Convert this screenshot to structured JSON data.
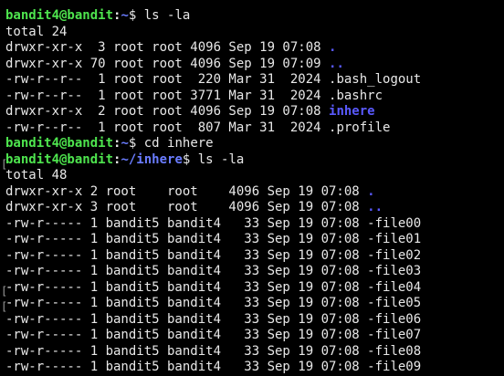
{
  "session": {
    "user_host": "bandit4@bandit",
    "colors": {
      "prompt": "#4ee44e",
      "path": "#6a7cff",
      "directory": "#5a5aff",
      "text": "#e8e8e8",
      "background": "#000000"
    }
  },
  "block1": {
    "prompt_user": "bandit4@bandit",
    "prompt_colon": ":",
    "prompt_path": "~",
    "prompt_dollar": "$ ",
    "command": "ls -la",
    "total": "total 24",
    "rows": [
      {
        "meta": "drwxr-xr-x  3 root root 4096 Sep 19 07:08 ",
        "name": ".",
        "is_dir": true
      },
      {
        "meta": "drwxr-xr-x 70 root root 4096 Sep 19 07:09 ",
        "name": "..",
        "is_dir": true
      },
      {
        "meta": "-rw-r--r--  1 root root  220 Mar 31  2024 ",
        "name": ".bash_logout",
        "is_dir": false
      },
      {
        "meta": "-rw-r--r--  1 root root 3771 Mar 31  2024 ",
        "name": ".bashrc",
        "is_dir": false
      },
      {
        "meta": "drwxr-xr-x  2 root root 4096 Sep 19 07:08 ",
        "name": "inhere",
        "is_dir": true
      },
      {
        "meta": "-rw-r--r--  1 root root  807 Mar 31  2024 ",
        "name": ".profile",
        "is_dir": false
      }
    ]
  },
  "block2": {
    "prompt_user": "bandit4@bandit",
    "prompt_colon": ":",
    "prompt_path": "~",
    "prompt_dollar": "$ ",
    "command": "cd inhere"
  },
  "block3": {
    "prompt_user": "bandit4@bandit",
    "prompt_colon": ":",
    "prompt_path": "~/inhere",
    "prompt_dollar": "$ ",
    "command": "ls -la",
    "total": "total 48",
    "rows": [
      {
        "meta": "drwxr-xr-x 2 root    root    4096 Sep 19 07:08 ",
        "name": ".",
        "is_dir": true
      },
      {
        "meta": "drwxr-xr-x 3 root    root    4096 Sep 19 07:08 ",
        "name": "..",
        "is_dir": true
      },
      {
        "meta": "-rw-r----- 1 bandit5 bandit4   33 Sep 19 07:08 ",
        "name": "-file00",
        "is_dir": false
      },
      {
        "meta": "-rw-r----- 1 bandit5 bandit4   33 Sep 19 07:08 ",
        "name": "-file01",
        "is_dir": false
      },
      {
        "meta": "-rw-r----- 1 bandit5 bandit4   33 Sep 19 07:08 ",
        "name": "-file02",
        "is_dir": false
      },
      {
        "meta": "-rw-r----- 1 bandit5 bandit4   33 Sep 19 07:08 ",
        "name": "-file03",
        "is_dir": false
      },
      {
        "meta": "-rw-r----- 1 bandit5 bandit4   33 Sep 19 07:08 ",
        "name": "-file04",
        "is_dir": false
      },
      {
        "meta": "-rw-r----- 1 bandit5 bandit4   33 Sep 19 07:08 ",
        "name": "-file05",
        "is_dir": false
      },
      {
        "meta": "-rw-r----- 1 bandit5 bandit4   33 Sep 19 07:08 ",
        "name": "-file06",
        "is_dir": false
      },
      {
        "meta": "-rw-r----- 1 bandit5 bandit4   33 Sep 19 07:08 ",
        "name": "-file07",
        "is_dir": false
      },
      {
        "meta": "-rw-r----- 1 bandit5 bandit4   33 Sep 19 07:08 ",
        "name": "-file08",
        "is_dir": false
      },
      {
        "meta": "-rw-r----- 1 bandit5 bandit4   33 Sep 19 07:08 ",
        "name": "-file09",
        "is_dir": false
      }
    ]
  }
}
